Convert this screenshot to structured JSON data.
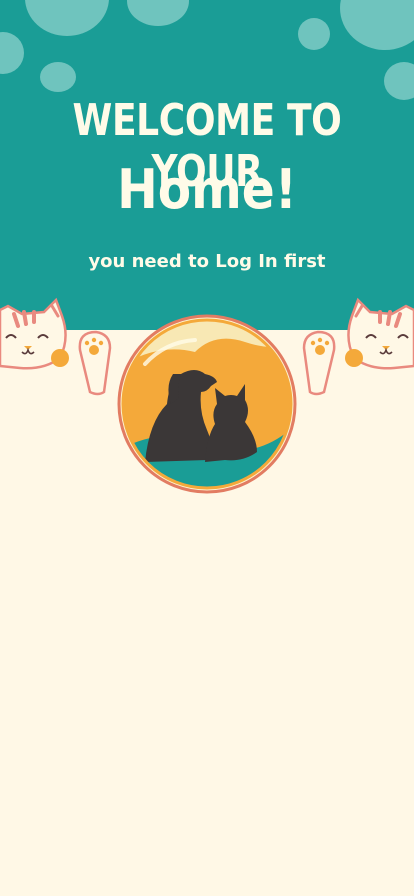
{
  "welcome": {
    "line1": "WELCOME TO YOUR",
    "line2": "Home!",
    "subtitle": "you need to Log In first"
  },
  "icons": {
    "cat_left": "waving-cat-icon",
    "cat_right": "waving-cat-icon",
    "logo": "dog-and-cat-logo"
  },
  "colors": {
    "teal": "#1a9d96",
    "cream": "#fff8e6",
    "bubble": "#6fc4be",
    "orange": "#f4a93a",
    "dark": "#3b3737",
    "pink": "#e98a7f"
  }
}
